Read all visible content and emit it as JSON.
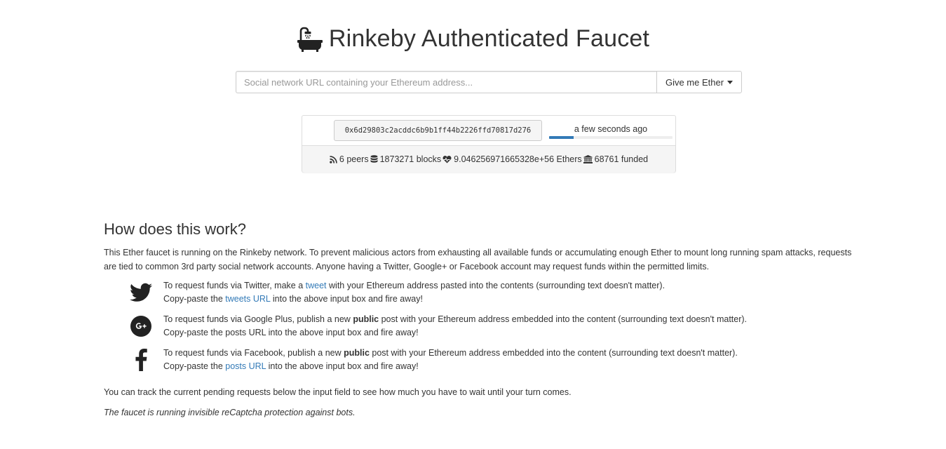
{
  "header": {
    "title": "Rinkeby Authenticated Faucet",
    "icon": "bath-icon"
  },
  "request_form": {
    "placeholder": "Social network URL containing your Ethereum address...",
    "value": "",
    "button_label": "Give me Ether"
  },
  "pending_request": {
    "address": "0x6d29803c2acddc6b9b1ff44b2226ffd70817d276",
    "time": "a few seconds ago",
    "progress_fraction": 0.2
  },
  "stats": {
    "peers": "6 peers",
    "blocks": "1873271 blocks",
    "ethers": "9.046256971665328e+56 Ethers",
    "funded": "68761 funded"
  },
  "how": {
    "heading": "How does this work?",
    "intro": "This Ether faucet is running on the Rinkeby network. To prevent malicious actors from exhausting all available funds or accumulating enough Ether to mount long running spam attacks, requests are tied to common 3rd party social network accounts. Anyone having a Twitter, Google+ or Facebook account may request funds within the permitted limits.",
    "twitter": {
      "line1_a": "To request funds via Twitter, make a ",
      "line1_link": "tweet",
      "line1_b": " with your Ethereum address pasted into the contents (surrounding text doesn't matter).",
      "line2_a": "Copy-paste the ",
      "line2_link": "tweets URL",
      "line2_b": " into the above input box and fire away!"
    },
    "google": {
      "line1_a": "To request funds via Google Plus, publish a new ",
      "line1_bold": "public",
      "line1_b": " post with your Ethereum address embedded into the content (surrounding text doesn't matter).",
      "line2": "Copy-paste the posts URL into the above input box and fire away!"
    },
    "facebook": {
      "line1_a": "To request funds via Facebook, publish a new ",
      "line1_bold": "public",
      "line1_b": " post with your Ethereum address embedded into the content (surrounding text doesn't matter).",
      "line2_a": "Copy-paste the ",
      "line2_link": "posts URL",
      "line2_b": " into the above input box and fire away!"
    },
    "tracking": "You can track the current pending requests below the input field to see how much you have to wait until your turn comes.",
    "captcha_note": "The faucet is running invisible reCaptcha protection against bots."
  },
  "colors": {
    "link": "#337ab7",
    "progress": "#337ab7",
    "text": "#333333"
  }
}
